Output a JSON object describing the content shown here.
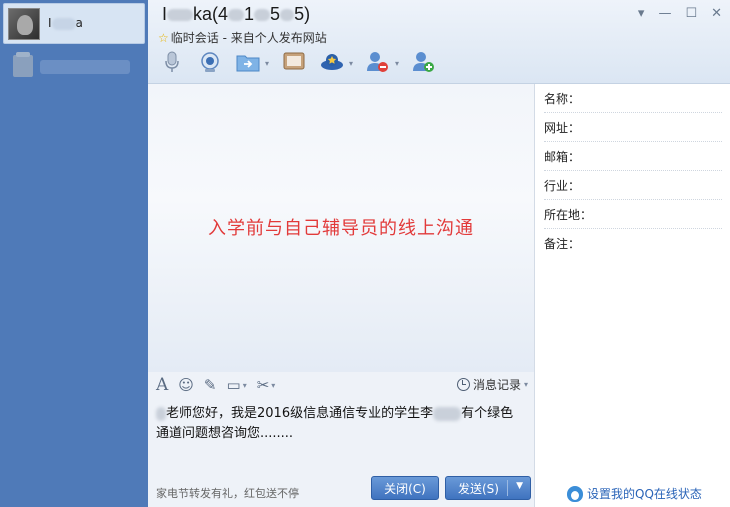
{
  "sidebar": {
    "active_contact": {
      "name_prefix": "I",
      "name_suffix": "a"
    }
  },
  "header": {
    "title_prefix": "I",
    "title_mid": "ka(4",
    "title_mid2": "1",
    "title_mid3": "5",
    "title_suffix": "5)",
    "subtitle": "临时会话 - 来自个人发布网站"
  },
  "chat": {
    "annotation": "入学前与自己辅导员的线上沟通"
  },
  "input_toolbar": {
    "history_label": "消息记录"
  },
  "message": {
    "part1": "老师您好，我是2016级信息通信专业的学生李",
    "part2": "有个绿色通道问题想咨询您........"
  },
  "bottom": {
    "ad_text": "家电节转发有礼，红包送不停",
    "close_label": "关闭(C)",
    "send_label": "发送(S)"
  },
  "info_panel": {
    "fields": [
      "名称：",
      "网址：",
      "邮箱：",
      "行业：",
      "所在地：",
      "备注："
    ],
    "qq_status": "设置我的QQ在线状态"
  },
  "colors": {
    "sidebar": "#4f7ab8",
    "button": "#3f73bf",
    "annotation": "#e23a3a"
  }
}
